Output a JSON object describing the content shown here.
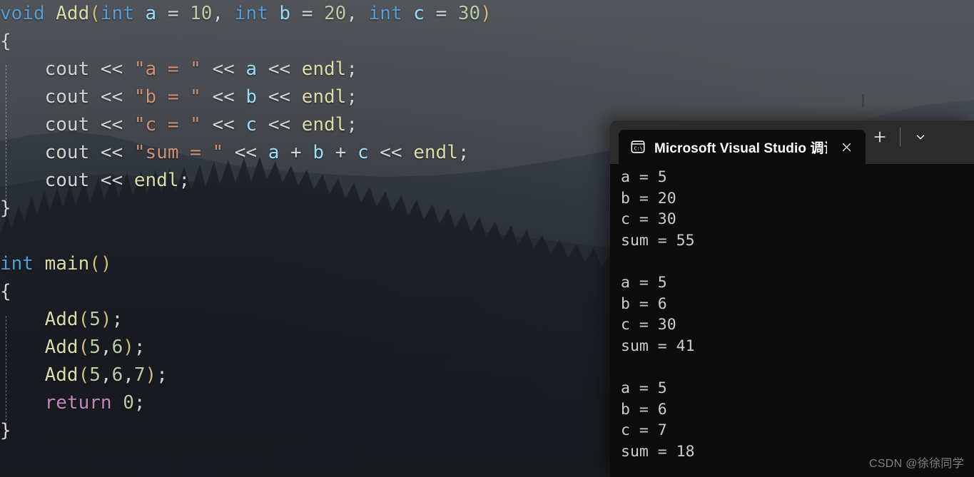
{
  "editor": {
    "name": "code-editor",
    "font_size_px": 26,
    "background_wallpaper": "forest-mountain-silhouette",
    "code_lines": [
      {
        "indent": 0,
        "tokens": [
          {
            "t": "void",
            "c": "kw"
          },
          {
            "t": " ",
            "c": "plain"
          },
          {
            "t": "Add",
            "c": "fn"
          },
          {
            "t": "(",
            "c": "paren"
          },
          {
            "t": "int",
            "c": "kw"
          },
          {
            "t": " ",
            "c": "plain"
          },
          {
            "t": "a",
            "c": "var"
          },
          {
            "t": " = ",
            "c": "op"
          },
          {
            "t": "10",
            "c": "num"
          },
          {
            "t": ", ",
            "c": "op"
          },
          {
            "t": "int",
            "c": "kw"
          },
          {
            "t": " ",
            "c": "plain"
          },
          {
            "t": "b",
            "c": "var"
          },
          {
            "t": " = ",
            "c": "op"
          },
          {
            "t": "20",
            "c": "num"
          },
          {
            "t": ", ",
            "c": "op"
          },
          {
            "t": "int",
            "c": "kw"
          },
          {
            "t": " ",
            "c": "plain"
          },
          {
            "t": "c",
            "c": "var"
          },
          {
            "t": " = ",
            "c": "op"
          },
          {
            "t": "30",
            "c": "num"
          },
          {
            "t": ")",
            "c": "paren"
          }
        ]
      },
      {
        "indent": 0,
        "tokens": [
          {
            "t": "{",
            "c": "br"
          }
        ]
      },
      {
        "indent": 0,
        "tokens": [
          {
            "t": "    cout",
            "c": "plain"
          },
          {
            "t": " << ",
            "c": "op"
          },
          {
            "t": "\"",
            "c": "str"
          },
          {
            "t": "a = ",
            "c": "str"
          },
          {
            "t": "\"",
            "c": "str"
          },
          {
            "t": " << ",
            "c": "op"
          },
          {
            "t": "a",
            "c": "var"
          },
          {
            "t": " << ",
            "c": "op"
          },
          {
            "t": "endl",
            "c": "fn"
          },
          {
            "t": ";",
            "c": "op"
          }
        ]
      },
      {
        "indent": 0,
        "tokens": [
          {
            "t": "    cout",
            "c": "plain"
          },
          {
            "t": " << ",
            "c": "op"
          },
          {
            "t": "\"",
            "c": "str"
          },
          {
            "t": "b = ",
            "c": "str"
          },
          {
            "t": "\"",
            "c": "str"
          },
          {
            "t": " << ",
            "c": "op"
          },
          {
            "t": "b",
            "c": "var"
          },
          {
            "t": " << ",
            "c": "op"
          },
          {
            "t": "endl",
            "c": "fn"
          },
          {
            "t": ";",
            "c": "op"
          }
        ]
      },
      {
        "indent": 0,
        "tokens": [
          {
            "t": "    cout",
            "c": "plain"
          },
          {
            "t": " << ",
            "c": "op"
          },
          {
            "t": "\"",
            "c": "str"
          },
          {
            "t": "c = ",
            "c": "str"
          },
          {
            "t": "\"",
            "c": "str"
          },
          {
            "t": " << ",
            "c": "op"
          },
          {
            "t": "c",
            "c": "var"
          },
          {
            "t": " << ",
            "c": "op"
          },
          {
            "t": "endl",
            "c": "fn"
          },
          {
            "t": ";",
            "c": "op"
          }
        ]
      },
      {
        "indent": 0,
        "tokens": [
          {
            "t": "    cout",
            "c": "plain"
          },
          {
            "t": " << ",
            "c": "op"
          },
          {
            "t": "\"",
            "c": "str"
          },
          {
            "t": "sum = ",
            "c": "str"
          },
          {
            "t": "\"",
            "c": "str"
          },
          {
            "t": " << ",
            "c": "op"
          },
          {
            "t": "a",
            "c": "var"
          },
          {
            "t": " + ",
            "c": "op"
          },
          {
            "t": "b",
            "c": "var"
          },
          {
            "t": " + ",
            "c": "op"
          },
          {
            "t": "c",
            "c": "var"
          },
          {
            "t": " << ",
            "c": "op"
          },
          {
            "t": "endl",
            "c": "fn"
          },
          {
            "t": ";",
            "c": "op"
          }
        ]
      },
      {
        "indent": 0,
        "tokens": [
          {
            "t": "    cout",
            "c": "plain"
          },
          {
            "t": " << ",
            "c": "op"
          },
          {
            "t": "endl",
            "c": "fn"
          },
          {
            "t": ";",
            "c": "op"
          }
        ]
      },
      {
        "indent": 0,
        "tokens": [
          {
            "t": "}",
            "c": "br"
          }
        ]
      },
      {
        "indent": 0,
        "tokens": [
          {
            "t": "",
            "c": "plain"
          }
        ]
      },
      {
        "indent": 0,
        "tokens": [
          {
            "t": "int",
            "c": "kw"
          },
          {
            "t": " ",
            "c": "plain"
          },
          {
            "t": "main",
            "c": "fn"
          },
          {
            "t": "()",
            "c": "paren"
          }
        ]
      },
      {
        "indent": 0,
        "tokens": [
          {
            "t": "{",
            "c": "br"
          }
        ]
      },
      {
        "indent": 0,
        "tokens": [
          {
            "t": "    ",
            "c": "plain"
          },
          {
            "t": "Add",
            "c": "fn"
          },
          {
            "t": "(",
            "c": "paren"
          },
          {
            "t": "5",
            "c": "num"
          },
          {
            "t": ")",
            "c": "paren"
          },
          {
            "t": ";",
            "c": "op"
          }
        ]
      },
      {
        "indent": 0,
        "tokens": [
          {
            "t": "    ",
            "c": "plain"
          },
          {
            "t": "Add",
            "c": "fn"
          },
          {
            "t": "(",
            "c": "paren"
          },
          {
            "t": "5",
            "c": "num"
          },
          {
            "t": ",",
            "c": "op"
          },
          {
            "t": "6",
            "c": "num"
          },
          {
            "t": ")",
            "c": "paren"
          },
          {
            "t": ";",
            "c": "op"
          }
        ]
      },
      {
        "indent": 0,
        "tokens": [
          {
            "t": "    ",
            "c": "plain"
          },
          {
            "t": "Add",
            "c": "fn"
          },
          {
            "t": "(",
            "c": "paren"
          },
          {
            "t": "5",
            "c": "num"
          },
          {
            "t": ",",
            "c": "op"
          },
          {
            "t": "6",
            "c": "num"
          },
          {
            "t": ",",
            "c": "op"
          },
          {
            "t": "7",
            "c": "num"
          },
          {
            "t": ")",
            "c": "paren"
          },
          {
            "t": ";",
            "c": "op"
          }
        ]
      },
      {
        "indent": 0,
        "tokens": [
          {
            "t": "    ",
            "c": "plain"
          },
          {
            "t": "return",
            "c": "ret"
          },
          {
            "t": " ",
            "c": "plain"
          },
          {
            "t": "0",
            "c": "num"
          },
          {
            "t": ";",
            "c": "op"
          }
        ]
      },
      {
        "indent": 0,
        "tokens": [
          {
            "t": "}",
            "c": "br"
          }
        ]
      }
    ],
    "syntax_colors": {
      "keyword": "#569cd6",
      "function": "#dcdcaa",
      "variable": "#9cdcfe",
      "number": "#b5cea8",
      "string": "#ce9178",
      "operator": "#d4d4d4",
      "control_keyword": "#c586c0",
      "paren": "#d7ba7d"
    }
  },
  "terminal": {
    "name": "windows-terminal",
    "tab": {
      "icon": "command-prompt-icon",
      "title": "Microsoft Visual Studio 调试挂",
      "close_label": "✕"
    },
    "controls": {
      "new_tab_label": "＋",
      "dropdown_label": "⌄"
    },
    "colors": {
      "titlebar_bg": "#2b2b2b",
      "tab_bg": "#0c0c0c",
      "body_bg": "#0c0c0c",
      "text": "#cccccc"
    },
    "output_lines": [
      "a = 5",
      "b = 20",
      "c = 30",
      "sum = 55",
      "",
      "a = 5",
      "b = 6",
      "c = 30",
      "sum = 41",
      "",
      "a = 5",
      "b = 6",
      "c = 7",
      "sum = 18"
    ]
  },
  "watermark": {
    "text": "CSDN @徐徐同学"
  }
}
